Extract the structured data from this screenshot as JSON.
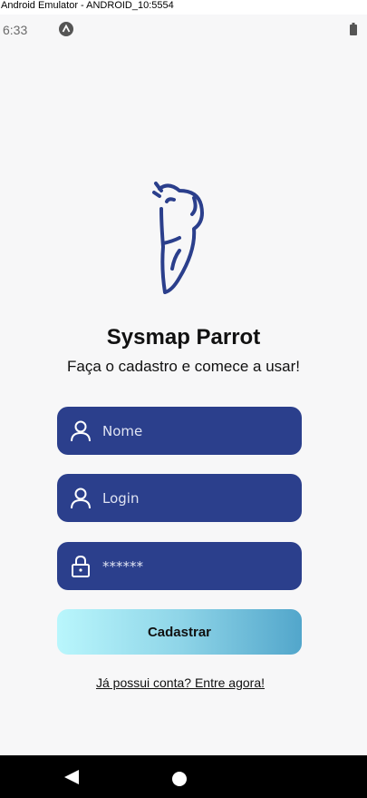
{
  "window": {
    "title": "Android Emulator - ANDROID_10:5554"
  },
  "status_bar": {
    "time": "6:33",
    "notification_icon": "notification-icon",
    "battery_icon": "battery-icon"
  },
  "logo": {
    "icon": "parrot-logo-icon",
    "color": "#2b3f8c"
  },
  "header": {
    "title": "Sysmap Parrot",
    "subtitle": "Faça o cadastro e comece a usar!"
  },
  "form": {
    "name_placeholder": "Nome",
    "login_placeholder": "Login",
    "password_value": "******",
    "field_color": "#2b3f8c"
  },
  "actions": {
    "submit_label": "Cadastrar",
    "login_link": "Já possui conta? Entre agora!"
  },
  "nav_bar": {
    "back_icon": "back-triangle-icon",
    "home_icon": "home-circle-icon"
  }
}
